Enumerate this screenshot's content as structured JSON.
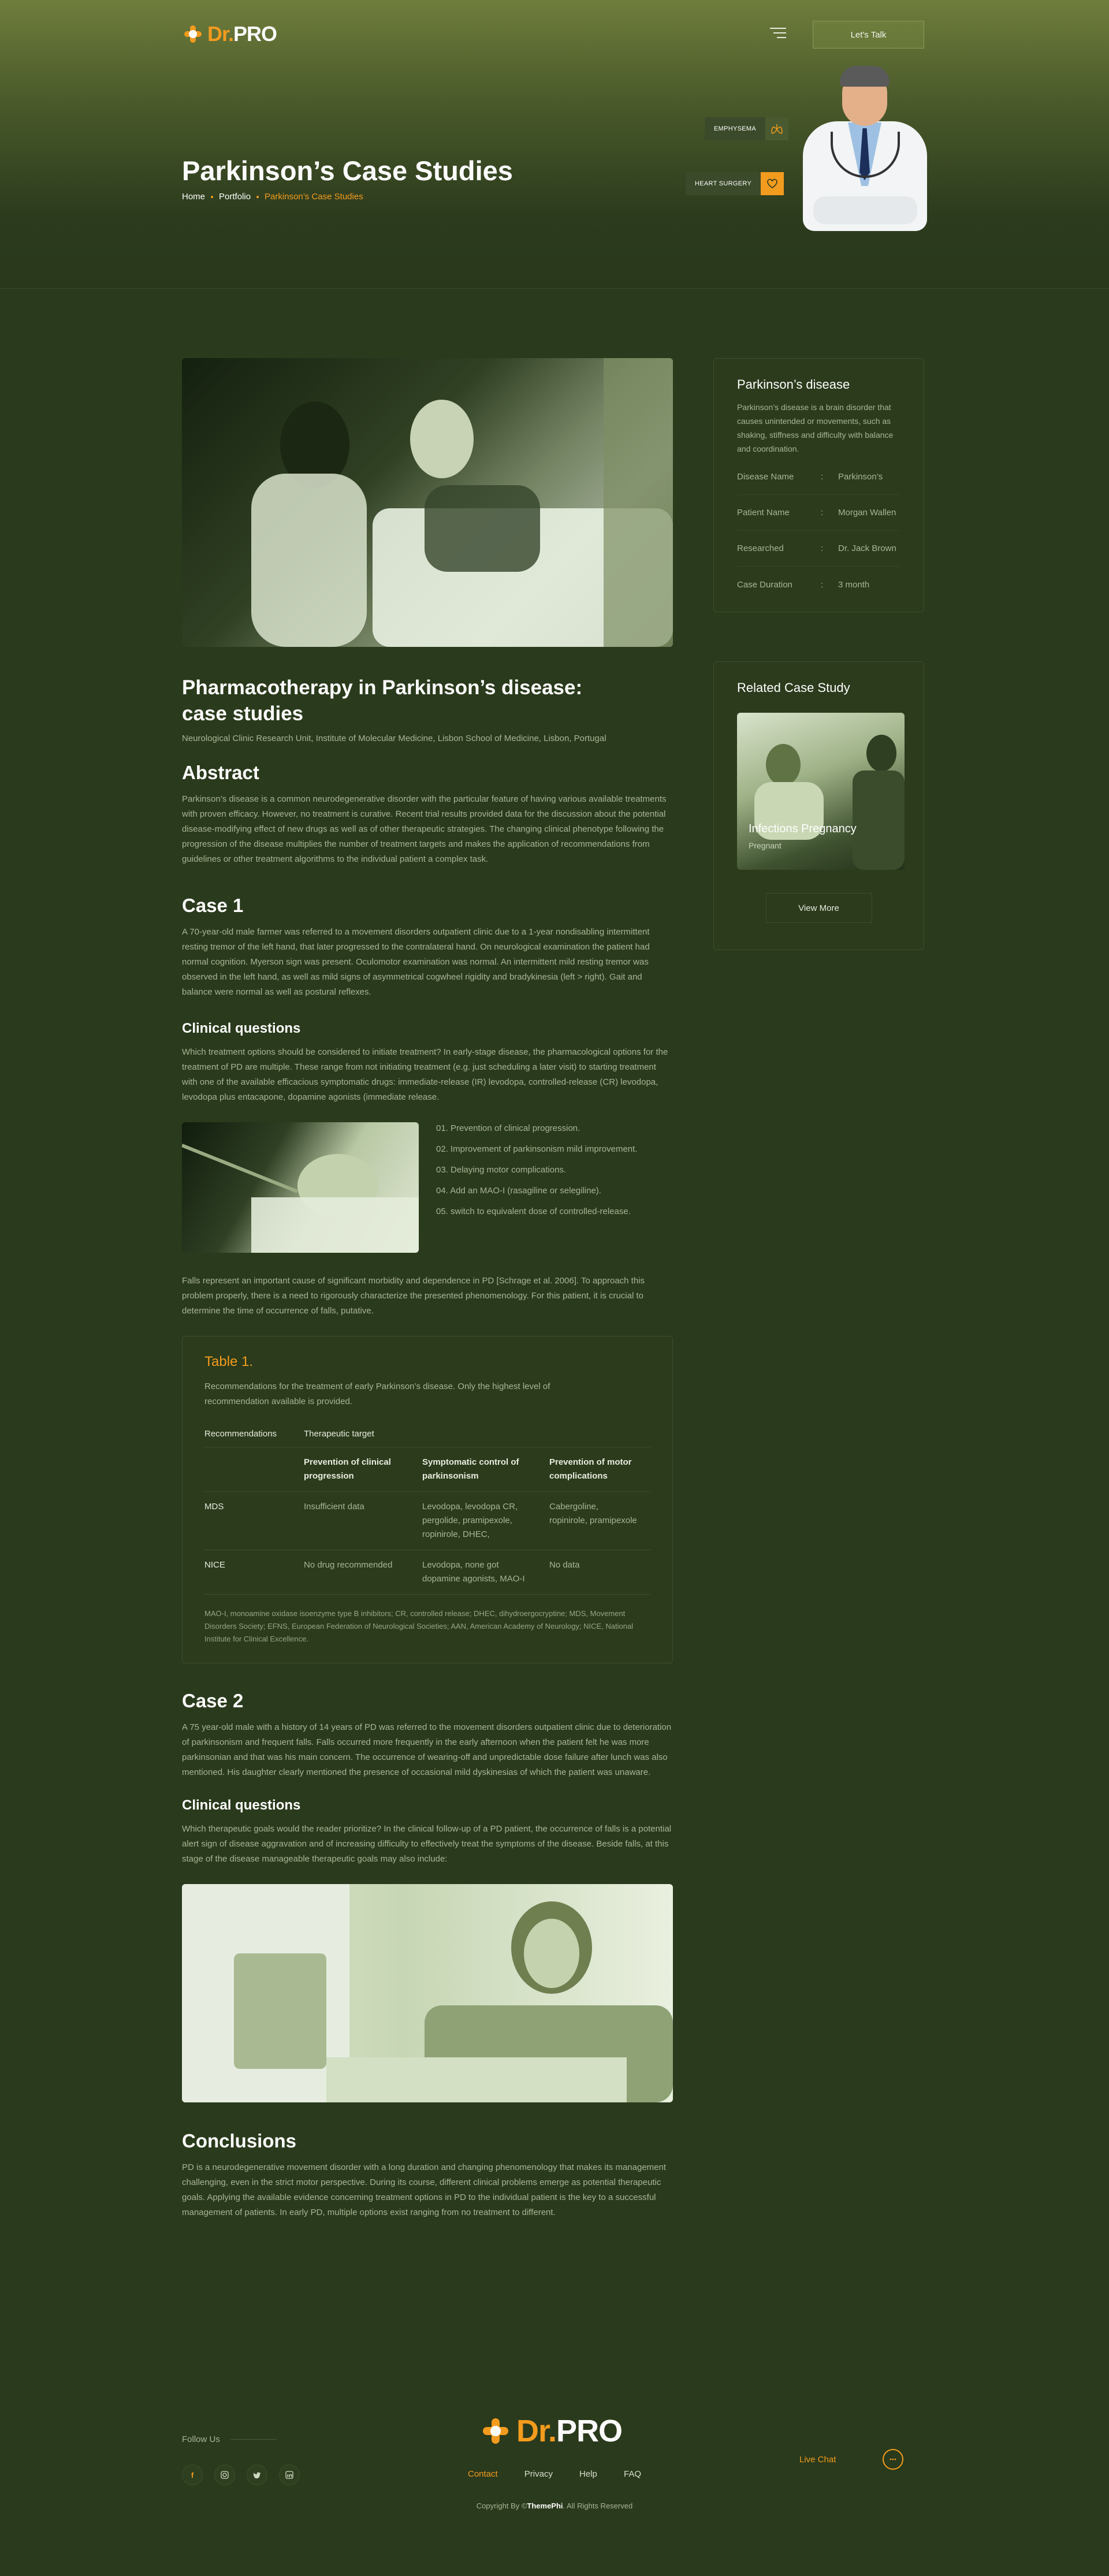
{
  "header": {
    "brand_dr": "Dr.",
    "brand_pro": "PRO",
    "talk_button": "Let's Talk",
    "page_title": "Parkinson’s Case Studies",
    "breadcrumb": [
      "Home",
      "Portfolio",
      "Parkinson’s Case Studies"
    ],
    "tags": [
      "EMPHYSEMA",
      "HEART SURGERY"
    ]
  },
  "article": {
    "title_line1": "Pharmacotherapy in Parkinson’s disease:",
    "title_line2": "case studies",
    "affiliation": "Neurological Clinic Research Unit, Institute of Molecular Medicine, Lisbon School of Medicine, Lisbon, Portugal",
    "abstract_heading": "Abstract",
    "abstract_text": "Parkinson’s disease is a common neurodegenerative disorder with the particular feature of having various available treatments with proven efficacy. However, no treatment is curative. Recent trial results provided data for the discussion about the potential disease-modifying effect of new drugs as well as of other therapeutic strategies. The changing clinical phenotype following the progression of the disease multiplies the number of treatment targets and makes the application of recommendations from guidelines or other treatment algorithms to the individual patient a complex task.",
    "case1_heading": "Case 1",
    "case1_text": "A 70-year-old male farmer was referred to a movement disorders outpatient clinic due to a 1-year nondisabling intermittent resting tremor of the left hand, that later progressed to the contralateral hand. On neurological examination the patient had normal cognition. Myerson sign was present. Oculomotor examination was normal. An intermittent mild resting tremor was observed in the left hand, as well as mild signs of asymmetrical cogwheel rigidity and bradykinesia (left > right). Gait and balance were normal as well as postural reflexes.",
    "cq1_heading": "Clinical questions",
    "cq1_text": "Which treatment options should be considered to initiate treatment? In early-stage disease, the pharmacological options for the treatment of PD are multiple. These range from not initiating treatment (e.g. just scheduling a later visit) to starting treatment with one of the available efficacious symptomatic drugs: immediate-release (IR) levodopa, controlled-release (CR) levodopa, levodopa plus entacapone, dopamine agonists (immediate release.",
    "options": [
      "01. Prevention of clinical progression.",
      "02. Improvement of parkinsonism mild improvement.",
      "03. Delaying motor complications.",
      "04. Add an MAO-I (rasagiline or selegiline).",
      "05. switch to equivalent dose of controlled-release."
    ],
    "falls_text": "Falls represent an important cause of significant morbidity and dependence in PD [Schrage et al. 2006]. To approach this problem properly, there is a need to rigorously characterize the presented phenomenology. For this patient, it is crucial to determine the time of occurrence of falls, putative.",
    "table": {
      "title": "Table 1.",
      "caption": "Recommendations for the treatment of early Parkinson’s disease. Only the highest level of recommendation available is provided.",
      "col_recommendations": "Recommendations",
      "col_target": "Therapeutic target",
      "subheaders": [
        "Prevention of clinical progression",
        "Symptomatic control of parkinsonism",
        "Prevention of motor complications"
      ],
      "rows": [
        {
          "name": "MDS",
          "cells": [
            "Insufficient data",
            "Levodopa, levodopa CR, pergolide, pramipexole, ropinirole, DHEC,",
            "Cabergoline, ropinirole, pramipexole"
          ]
        },
        {
          "name": "NICE",
          "cells": [
            "No drug recommended",
            "Levodopa, none got dopamine agonists, MAO-I",
            "No data"
          ]
        }
      ],
      "footnote": "MAO-I, monoamine oxidase isoenzyme type B inhibitors; CR, controlled release; DHEC, dihydroergocryptine; MDS, Movement Disorders Society; EFNS, European Federation of Neurological Societies; AAN, American Academy of Neurology; NICE, National Institute for Clinical Excellence."
    },
    "case2_heading": "Case 2",
    "case2_text": "A 75 year-old male with a history of 14 years of PD was referred to the movement disorders outpatient clinic due to deterioration of parkinsonism and frequent falls. Falls occurred more frequently in the early afternoon when the patient felt he was more parkinsonian and that was his main concern. The occurrence of wearing-off and unpredictable dose failure after lunch was also mentioned. His daughter clearly mentioned the presence of occasional mild dyskinesias of which the patient was unaware.",
    "cq2_heading": "Clinical questions",
    "cq2_text": "Which therapeutic goals would the reader prioritize? In the clinical follow-up of a PD patient, the occurrence of falls is a potential alert sign of disease aggravation and of increasing difficulty to effectively treat the symptoms of the disease. Beside falls, at this stage of the disease manageable therapeutic goals may also include:",
    "conclusions_heading": "Conclusions",
    "conclusions_text": "PD is a neurodegenerative movement disorder with a long duration and changing phenomenology that makes its management challenging, even in the strict motor perspective. During its course, different clinical problems emerge as potential therapeutic goals. Applying the available evidence concerning treatment options in PD to the individual patient is the key to a successful management of patients. In early PD, multiple options exist ranging from no treatment to different."
  },
  "sidebar": {
    "disease_title": "Parkinson’s disease",
    "disease_text": "Parkinson’s disease is a brain disorder that causes unintended or movements, such as shaking, stiffness and difficulty with balance and coordination.",
    "details": [
      {
        "key": "Disease Name",
        "value": "Parkinson’s"
      },
      {
        "key": "Patient Name",
        "value": "Morgan Wallen"
      },
      {
        "key": "Researched",
        "value": "Dr. Jack Brown"
      },
      {
        "key": "Case Duration",
        "value": "3 month"
      }
    ],
    "separator": ":",
    "related_title": "Related Case Study",
    "related_card_title": "Infections Pregnancy",
    "related_card_sub": "Pregnant",
    "view_more": "View More"
  },
  "footer": {
    "follow_us": "Follow Us",
    "links": [
      "Contact",
      "Privacy",
      "Help",
      "FAQ"
    ],
    "live_chat": "Live Chat",
    "copyright_pre": "Copyright By ©",
    "copyright_brand": "ThemePhi",
    "copyright_post": ". All Rights Reserved"
  },
  "colors": {
    "accent": "#f39b1e",
    "background": "#2a3a1c",
    "muted_text": "#a9b596"
  }
}
